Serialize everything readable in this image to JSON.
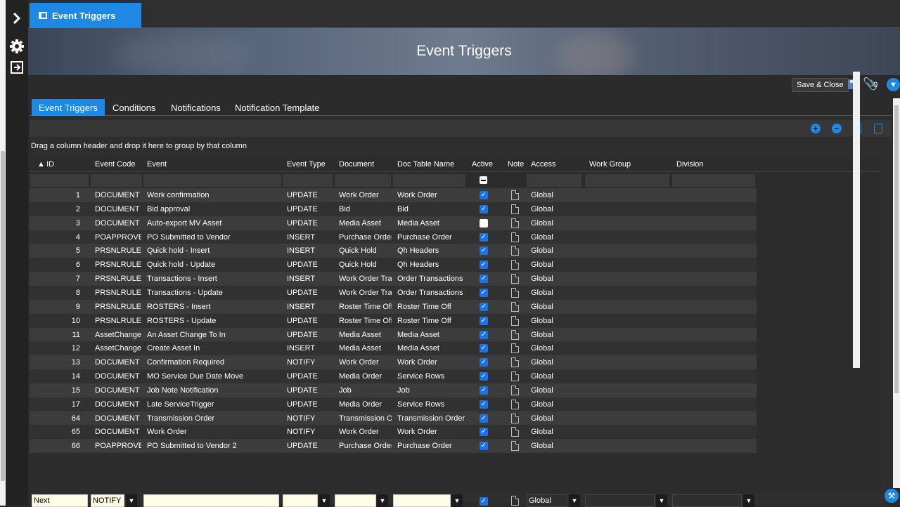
{
  "app_tab": {
    "label": "Event Triggers"
  },
  "banner": {
    "title": "Event Triggers"
  },
  "actions": {
    "save_close": "Save & Close",
    "attachments_count": "0"
  },
  "tabs": [
    "Event Triggers",
    "Conditions",
    "Notifications",
    "Notification Template"
  ],
  "group_hint": "Drag a column header and drop it here to group by that column",
  "columns": [
    "ID",
    "Event Code",
    "Event",
    "Event Type",
    "Document",
    "Doc Table Name",
    "Active",
    "Note",
    "Access",
    "Work Group",
    "Division"
  ],
  "rows": [
    {
      "id": "1",
      "code": "DOCUMENT",
      "event": "Work confirmation",
      "type": "UPDATE",
      "doc": "Work Order",
      "table": "Work Order",
      "active": true,
      "access": "Global"
    },
    {
      "id": "2",
      "code": "DOCUMENT",
      "event": "Bid approval",
      "type": "UPDATE",
      "doc": "Bid",
      "table": "Bid",
      "active": true,
      "access": "Global"
    },
    {
      "id": "3",
      "code": "DOCUMENT",
      "event": "Auto-export MV Asset",
      "type": "UPDATE",
      "doc": "Media Asset",
      "table": "Media Asset",
      "active": false,
      "access": "Global"
    },
    {
      "id": "4",
      "code": "POAPPROVEI",
      "event": "PO Submitted to Vendor",
      "type": "INSERT",
      "doc": "Purchase Order",
      "table": "Purchase Order",
      "active": true,
      "access": "Global"
    },
    {
      "id": "5",
      "code": "PRSNLRULES",
      "event": "Quick hold - Insert",
      "type": "INSERT",
      "doc": "Quick Hold",
      "table": "Qh Headers",
      "active": true,
      "access": "Global"
    },
    {
      "id": "6",
      "code": "PRSNLRULES",
      "event": "Quick hold - Update",
      "type": "UPDATE",
      "doc": "Quick Hold",
      "table": "Qh Headers",
      "active": true,
      "access": "Global"
    },
    {
      "id": "7",
      "code": "PRSNLRULES",
      "event": "Transactions - Insert",
      "type": "INSERT",
      "doc": "Work Order Tran",
      "table": "Order Transactions",
      "active": true,
      "access": "Global"
    },
    {
      "id": "8",
      "code": "PRSNLRULES",
      "event": "Transactions - Update",
      "type": "UPDATE",
      "doc": "Work Order Tran",
      "table": "Order Transactions",
      "active": true,
      "access": "Global"
    },
    {
      "id": "9",
      "code": "PRSNLRULES",
      "event": "ROSTERS - Insert",
      "type": "INSERT",
      "doc": "Roster Time Off",
      "table": "Roster Time Off",
      "active": true,
      "access": "Global"
    },
    {
      "id": "10",
      "code": "PRSNLRULES",
      "event": "ROSTERS - Update",
      "type": "UPDATE",
      "doc": "Roster Time Off",
      "table": "Roster Time Off",
      "active": true,
      "access": "Global"
    },
    {
      "id": "11",
      "code": "AssetChanged",
      "event": "An Asset Change To In",
      "type": "UPDATE",
      "doc": "Media Asset",
      "table": "Media Asset",
      "active": true,
      "access": "Global"
    },
    {
      "id": "12",
      "code": "AssetChanged",
      "event": "Create Asset In",
      "type": "INSERT",
      "doc": "Media Asset",
      "table": "Media Asset",
      "active": true,
      "access": "Global"
    },
    {
      "id": "13",
      "code": "DOCUMENT",
      "event": "Confirmation Required",
      "type": "NOTIFY",
      "doc": "Work Order",
      "table": "Work Order",
      "active": true,
      "access": "Global"
    },
    {
      "id": "14",
      "code": "DOCUMENT",
      "event": "MO Service Due Date Move",
      "type": "UPDATE",
      "doc": "Media Order",
      "table": "Service Rows",
      "active": true,
      "access": "Global"
    },
    {
      "id": "15",
      "code": "DOCUMENT",
      "event": "Job Note Notification",
      "type": "UPDATE",
      "doc": "Job",
      "table": "Job",
      "active": true,
      "access": "Global"
    },
    {
      "id": "17",
      "code": "DOCUMENT",
      "event": "Late ServiceTrigger",
      "type": "UPDATE",
      "doc": "Media Order",
      "table": "Service Rows",
      "active": true,
      "access": "Global"
    },
    {
      "id": "64",
      "code": "DOCUMENT",
      "event": "Transmission Order",
      "type": "NOTIFY",
      "doc": "Transmission Or",
      "table": "Transmission Order",
      "active": true,
      "access": "Global"
    },
    {
      "id": "65",
      "code": "DOCUMENT",
      "event": "Work Order",
      "type": "NOTIFY",
      "doc": "Work Order",
      "table": "Work Order",
      "active": true,
      "access": "Global"
    },
    {
      "id": "66",
      "code": "POAPPROVEI",
      "event": "PO Submitted to Vendor 2",
      "type": "UPDATE",
      "doc": "Purchase Order",
      "table": "Purchase Order",
      "active": true,
      "access": "Global"
    }
  ],
  "edit_row": {
    "id": "Next",
    "code": "NOTIFY",
    "event": "",
    "access": "Global"
  },
  "colors": {
    "accent": "#1e88e5"
  },
  "icons": {
    "expand": "chevron-right-icon",
    "settings": "gear-icon",
    "logout": "exit-icon",
    "add": "plus-circle-icon",
    "remove": "minus-circle-icon",
    "copy": "copy-icon",
    "export": "excel-icon"
  }
}
